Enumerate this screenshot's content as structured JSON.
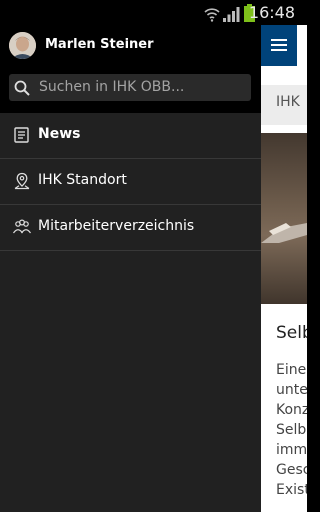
{
  "status_bar": {
    "time": "16:48"
  },
  "drawer": {
    "user_name": "Marlen Steiner",
    "search_placeholder": "Suchen in IHK OBB...",
    "items": [
      {
        "label": "News",
        "icon": "news-icon",
        "active": true
      },
      {
        "label": "IHK Standort",
        "icon": "map-pin-icon",
        "active": false
      },
      {
        "label": "Mitarbeiterverzeichnis",
        "icon": "people-icon",
        "active": false
      }
    ]
  },
  "content": {
    "category": "IHK",
    "article_title": "Selb",
    "article_lines": [
      "Eine",
      "unte",
      "Konz",
      "Selbs",
      "imme",
      "Gesc",
      "Exist"
    ]
  },
  "colors": {
    "appbar": "#00437a",
    "drawer_bg": "#212121",
    "header_bg": "#000000"
  }
}
